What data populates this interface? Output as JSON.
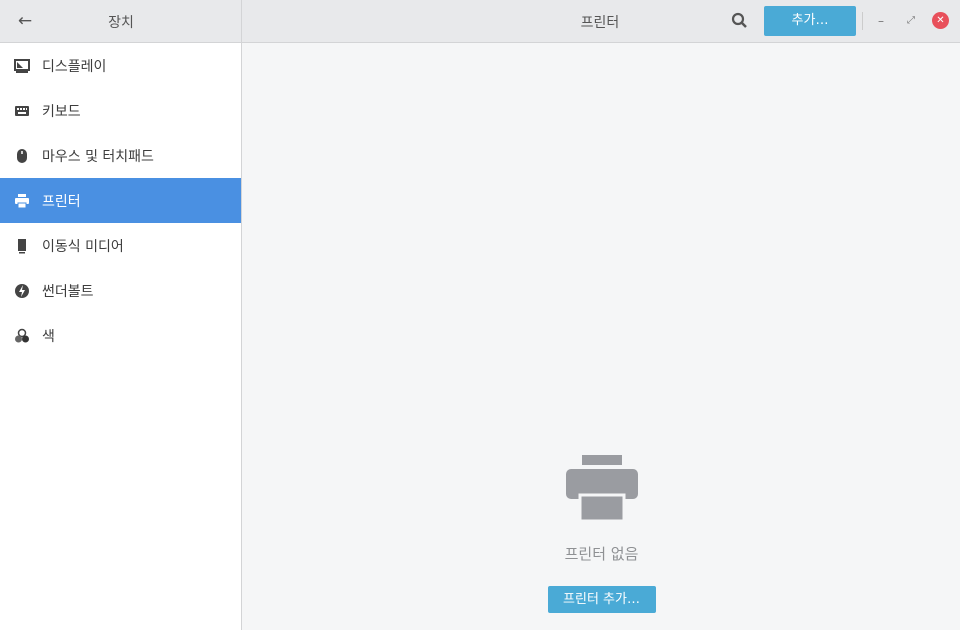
{
  "header": {
    "sidebar_title": "장치",
    "title": "프린터",
    "add_label": "추가…"
  },
  "sidebar": {
    "items": [
      {
        "label": "디스플레이",
        "icon": "display-icon"
      },
      {
        "label": "키보드",
        "icon": "keyboard-icon"
      },
      {
        "label": "마우스 및 터치패드",
        "icon": "mouse-icon"
      },
      {
        "label": "프린터",
        "icon": "printer-icon",
        "active": true
      },
      {
        "label": "이동식 미디어",
        "icon": "removable-media-icon"
      },
      {
        "label": "썬더볼트",
        "icon": "thunderbolt-icon"
      },
      {
        "label": "색",
        "icon": "color-icon"
      }
    ]
  },
  "main": {
    "empty_label": "프린터 없음",
    "add_printer_label": "프린터 추가…"
  },
  "colors": {
    "accent": "#4a90e2",
    "button": "#4aaad6",
    "close": "#e8505b"
  }
}
